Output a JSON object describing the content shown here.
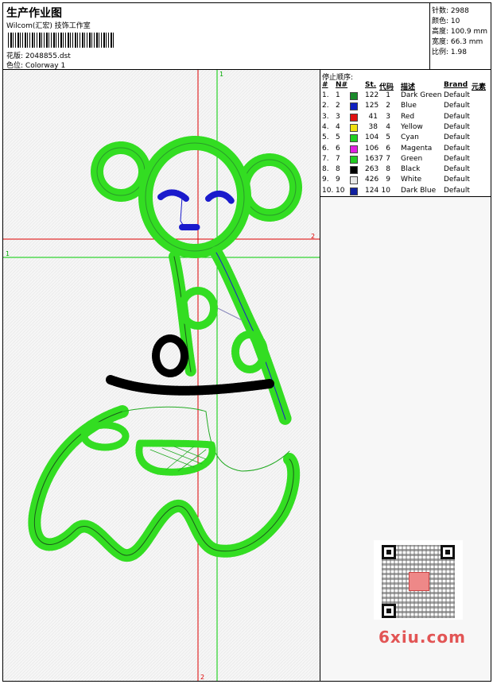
{
  "header": {
    "title": "生产作业图",
    "subtitle": "Wilcom(汇宏) 技饰工作室",
    "design_label": "花版:",
    "design_value": "2048855.dst",
    "colorway_label": "色位:",
    "colorway_value": "Colorway 1"
  },
  "stats": {
    "stitches": "针数: 2988",
    "colors": "颜色: 10",
    "height": "高度: 100.9 mm",
    "width": "宽度: 66.3 mm",
    "scale": "比例: 1.98"
  },
  "stop_sequence": {
    "title": "停止顺序:",
    "columns": [
      "#",
      "N#",
      "St.",
      "代码",
      "描述",
      "Brand",
      "元素"
    ],
    "rows": [
      {
        "idx": "1.",
        "n": "1",
        "color": "#1a8a2a",
        "st": "122",
        "code": "1",
        "desc": "Dark Green",
        "brand": "Default"
      },
      {
        "idx": "2.",
        "n": "2",
        "color": "#1020c0",
        "st": "125",
        "code": "2",
        "desc": "Blue",
        "brand": "Default"
      },
      {
        "idx": "3.",
        "n": "3",
        "color": "#e01010",
        "st": "41",
        "code": "3",
        "desc": "Red",
        "brand": "Default"
      },
      {
        "idx": "4.",
        "n": "4",
        "color": "#f0e010",
        "st": "38",
        "code": "4",
        "desc": "Yellow",
        "brand": "Default"
      },
      {
        "idx": "5.",
        "n": "5",
        "color": "#20d020",
        "st": "104",
        "code": "5",
        "desc": "Cyan",
        "brand": "Default"
      },
      {
        "idx": "6.",
        "n": "6",
        "color": "#e020e0",
        "st": "106",
        "code": "6",
        "desc": "Magenta",
        "brand": "Default"
      },
      {
        "idx": "7.",
        "n": "7",
        "color": "#22cc22",
        "st": "1637",
        "code": "7",
        "desc": "Green",
        "brand": "Default"
      },
      {
        "idx": "8.",
        "n": "8",
        "color": "#000000",
        "st": "263",
        "code": "8",
        "desc": "Black",
        "brand": "Default"
      },
      {
        "idx": "9.",
        "n": "9",
        "color": "#e8e8e8",
        "st": "426",
        "code": "9",
        "desc": "White",
        "brand": "Default"
      },
      {
        "idx": "10.",
        "n": "10",
        "color": "#1020a0",
        "st": "124",
        "code": "10",
        "desc": "Dark Blue",
        "brand": "Default"
      }
    ]
  },
  "guides": {
    "v_red_label": "2",
    "v_red_bottom_label": "2",
    "v_green_label": "1",
    "h_red_label": "2",
    "h_green_label": "1"
  },
  "watermark": "6xiu.com",
  "colors": {
    "stitch_green": "#33dd22",
    "guide_red": "#dd0000",
    "guide_green": "#00cc00",
    "outline_dark": "#1a5a1a",
    "blue": "#1a1acc"
  }
}
